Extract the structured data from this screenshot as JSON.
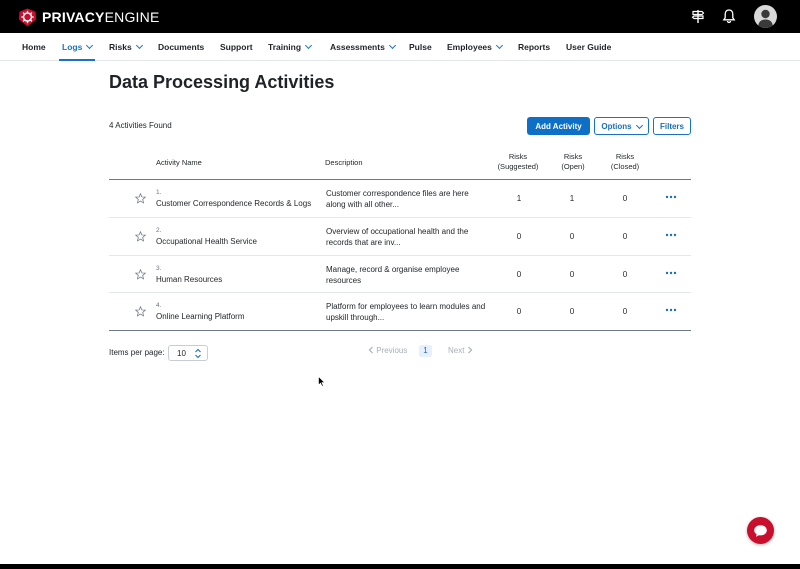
{
  "brand": {
    "name_bold": "PRIVACY",
    "name_regular": "ENGINE",
    "accent": "#c8102e"
  },
  "topbar_icons": [
    "signpost-icon",
    "bell-icon",
    "avatar"
  ],
  "nav": {
    "items": [
      {
        "label": "Home",
        "dropdown": false,
        "active": false
      },
      {
        "label": "Logs",
        "dropdown": true,
        "active": true
      },
      {
        "label": "Risks",
        "dropdown": true,
        "active": false
      },
      {
        "label": "Documents",
        "dropdown": false,
        "active": false
      },
      {
        "label": "Support",
        "dropdown": false,
        "active": false
      },
      {
        "label": "Training",
        "dropdown": true,
        "active": false
      },
      {
        "label": "Assessments",
        "dropdown": true,
        "active": false
      },
      {
        "label": "Pulse",
        "dropdown": false,
        "active": false
      },
      {
        "label": "Employees",
        "dropdown": true,
        "active": false
      },
      {
        "label": "Reports",
        "dropdown": false,
        "active": false
      },
      {
        "label": "User Guide",
        "dropdown": false,
        "active": false
      }
    ]
  },
  "page": {
    "title": "Data Processing Activities",
    "count_text": "4 Activities Found"
  },
  "actions": {
    "add_label": "Add Activity",
    "options_label": "Options",
    "filters_label": "Filters"
  },
  "table": {
    "headers": {
      "name": "Activity Name",
      "description": "Description",
      "risks_suggested": [
        "Risks",
        "(Suggested)"
      ],
      "risks_open": [
        "Risks",
        "(Open)"
      ],
      "risks_closed": [
        "Risks",
        "(Closed)"
      ]
    },
    "rows": [
      {
        "num": "1.",
        "name": "Customer Correspondence Records & Logs",
        "desc": "Customer correspondence files are here along with all other...",
        "suggested": "1",
        "open": "1",
        "closed": "0"
      },
      {
        "num": "2.",
        "name": "Occupational Health Service",
        "desc": "Overview of occupational health and the records that are inv...",
        "suggested": "0",
        "open": "0",
        "closed": "0"
      },
      {
        "num": "3.",
        "name": "Human Resources",
        "desc": "Manage, record & organise employee resources",
        "suggested": "0",
        "open": "0",
        "closed": "0"
      },
      {
        "num": "4.",
        "name": "Online Learning Platform",
        "desc": "Platform for employees to learn modules and upskill through...",
        "suggested": "0",
        "open": "0",
        "closed": "0"
      }
    ]
  },
  "pagination": {
    "items_per_page_label": "Items per page:",
    "items_per_page_value": "10",
    "prev_label": "Previous",
    "current_page": "1",
    "next_label": "Next"
  },
  "colors": {
    "primary": "#0e6fc6",
    "topbar": "#000000",
    "chat": "#c8102e"
  }
}
